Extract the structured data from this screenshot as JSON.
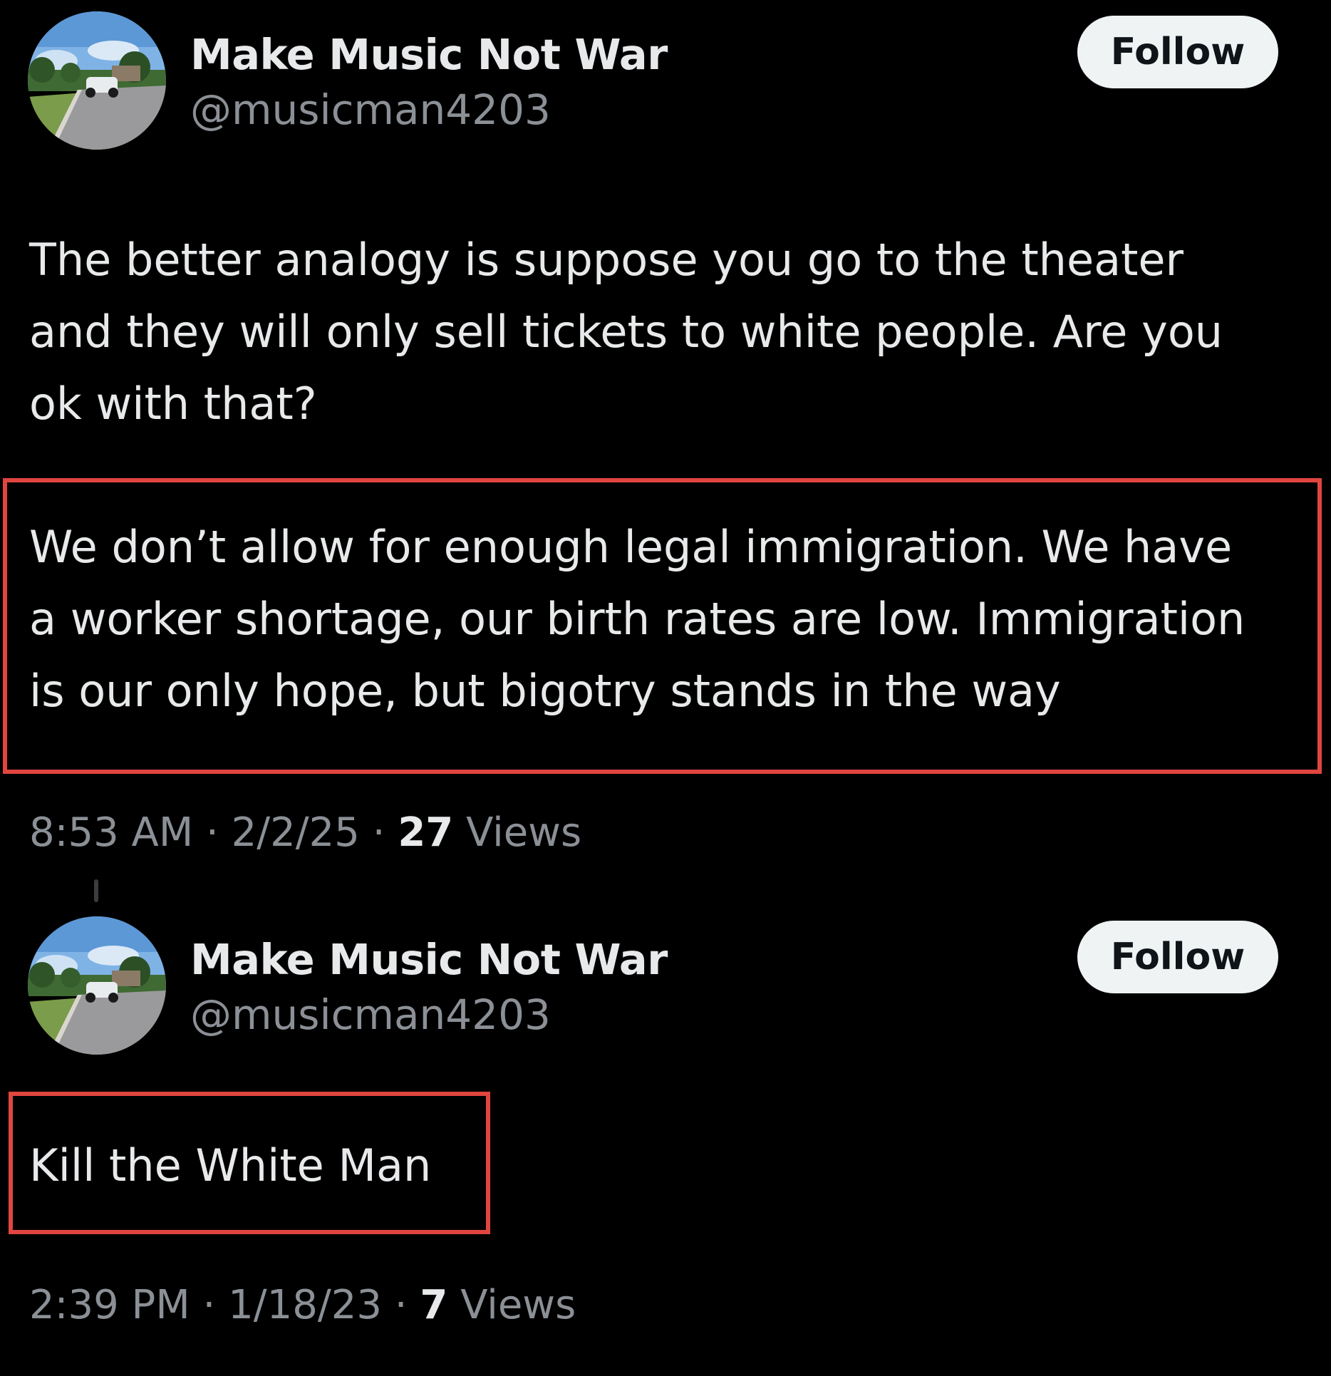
{
  "posts": [
    {
      "author": {
        "display_name": "Make Music Not War",
        "handle": "@musicman4203",
        "avatar_icon": "avatar-photo-road-car"
      },
      "follow_label": "Follow",
      "text_lines": [
        "The better analogy is suppose you go to the theater",
        "and they will only sell tickets to white people. Are you",
        "ok with that?"
      ],
      "highlighted_lines": [
        "We don’t allow for enough legal immigration. We have",
        "a worker shortage, our birth rates are low. Immigration",
        "is our only hope, but bigotry stands in the way"
      ],
      "time": "8:53 AM",
      "separator": "·",
      "date": "2/2/25",
      "views_count": "27",
      "views_label": "Views"
    },
    {
      "author": {
        "display_name": "Make Music Not War",
        "handle": "@musicman4203",
        "avatar_icon": "avatar-photo-road-car"
      },
      "follow_label": "Follow",
      "highlighted_lines": [
        "Kill the White Man"
      ],
      "time": "2:39 PM",
      "separator": "·",
      "date": "1/18/23",
      "views_count": "7",
      "views_label": "Views"
    }
  ],
  "colors": {
    "background": "#000000",
    "primary_text": "#e7e9ea",
    "secondary_text": "#8b9096",
    "follow_button_bg": "#eff3f4",
    "highlight_border": "#e0463f"
  }
}
